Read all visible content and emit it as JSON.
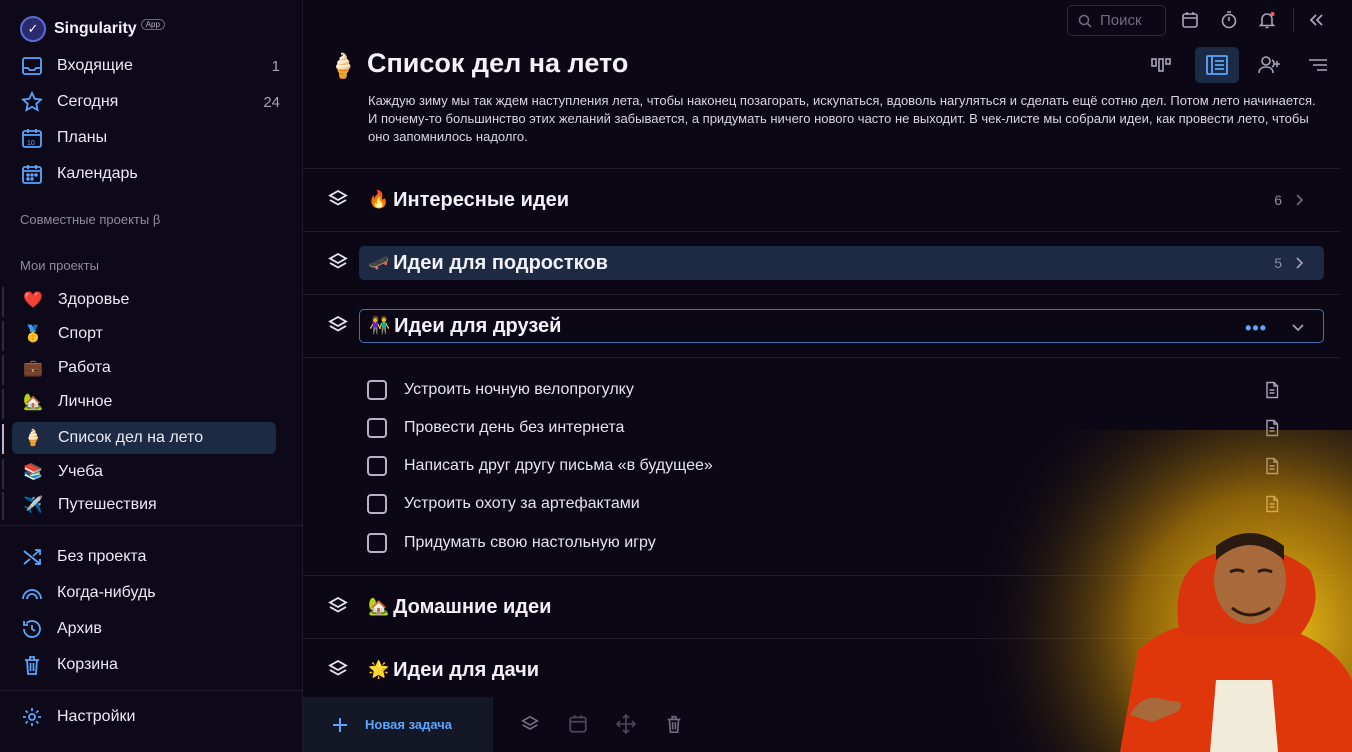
{
  "app": {
    "name": "Singularity",
    "badge": "App"
  },
  "nav_top": [
    {
      "label": "Входящие",
      "count": "1",
      "icon": "inbox-icon"
    },
    {
      "label": "Сегодня",
      "count": "24",
      "icon": "star-icon"
    },
    {
      "label": "Планы",
      "count": "",
      "icon": "calendar-10-icon"
    },
    {
      "label": "Календарь",
      "count": "",
      "icon": "calendar-icon"
    }
  ],
  "sections": {
    "shared": "Совместные проекты β",
    "mine": "Мои проекты"
  },
  "projects": [
    {
      "emoji": "❤️",
      "label": "Здоровье"
    },
    {
      "emoji": "🥇",
      "label": "Спорт"
    },
    {
      "emoji": "💼",
      "label": "Работа"
    },
    {
      "emoji": "🏡",
      "label": "Личное"
    },
    {
      "emoji": "🍦",
      "label": "Список дел на лето"
    },
    {
      "emoji": "📚",
      "label": "Учеба"
    },
    {
      "emoji": "✈️",
      "label": "Путешествия"
    }
  ],
  "nav_bottom": [
    {
      "label": "Без проекта",
      "icon": "shuffle-icon"
    },
    {
      "label": "Когда-нибудь",
      "icon": "rainbow-icon"
    },
    {
      "label": "Архив",
      "icon": "history-icon"
    },
    {
      "label": "Корзина",
      "icon": "trash-icon"
    }
  ],
  "settings": {
    "label": "Настройки",
    "icon": "gear-icon"
  },
  "search": {
    "placeholder": "Поиск"
  },
  "project": {
    "emoji": "🍦",
    "title": "Список дел на лето",
    "description": "Каждую зиму мы так ждем наступления лета, чтобы наконец позагорать, искупаться, вдоволь нагуляться и сделать ещё сотню дел. Потом лето начинается. И почему-то большинство этих желаний забывается, а придумать ничего нового часто не выходит. В чек-листе мы собрали идеи, как провести лето, чтобы оно запомнилось надолго."
  },
  "task_sections": [
    {
      "emoji": "🔥",
      "title": "Интересные идеи",
      "count": "6"
    },
    {
      "emoji": "🛹",
      "title": "Идеи для подростков",
      "count": "5"
    },
    {
      "emoji": "👫",
      "title": "Идеи для друзей",
      "count": ""
    },
    {
      "emoji": "🏡",
      "title": "Домашние идеи",
      "count": ""
    },
    {
      "emoji": "🌟",
      "title": "Идеи для дачи",
      "count": ""
    }
  ],
  "tasks": [
    "Устроить ночную велопрогулку",
    "Провести день без интернета",
    "Написать друг другу письма «в будущее»",
    "Устроить охоту за артефактами",
    "Придумать свою настольную игру"
  ],
  "bottom": {
    "new_task": "Новая задача"
  },
  "colors": {
    "accent": "#5aa6ff",
    "active_bg": "#1c2a44",
    "background": "#0b0714"
  }
}
